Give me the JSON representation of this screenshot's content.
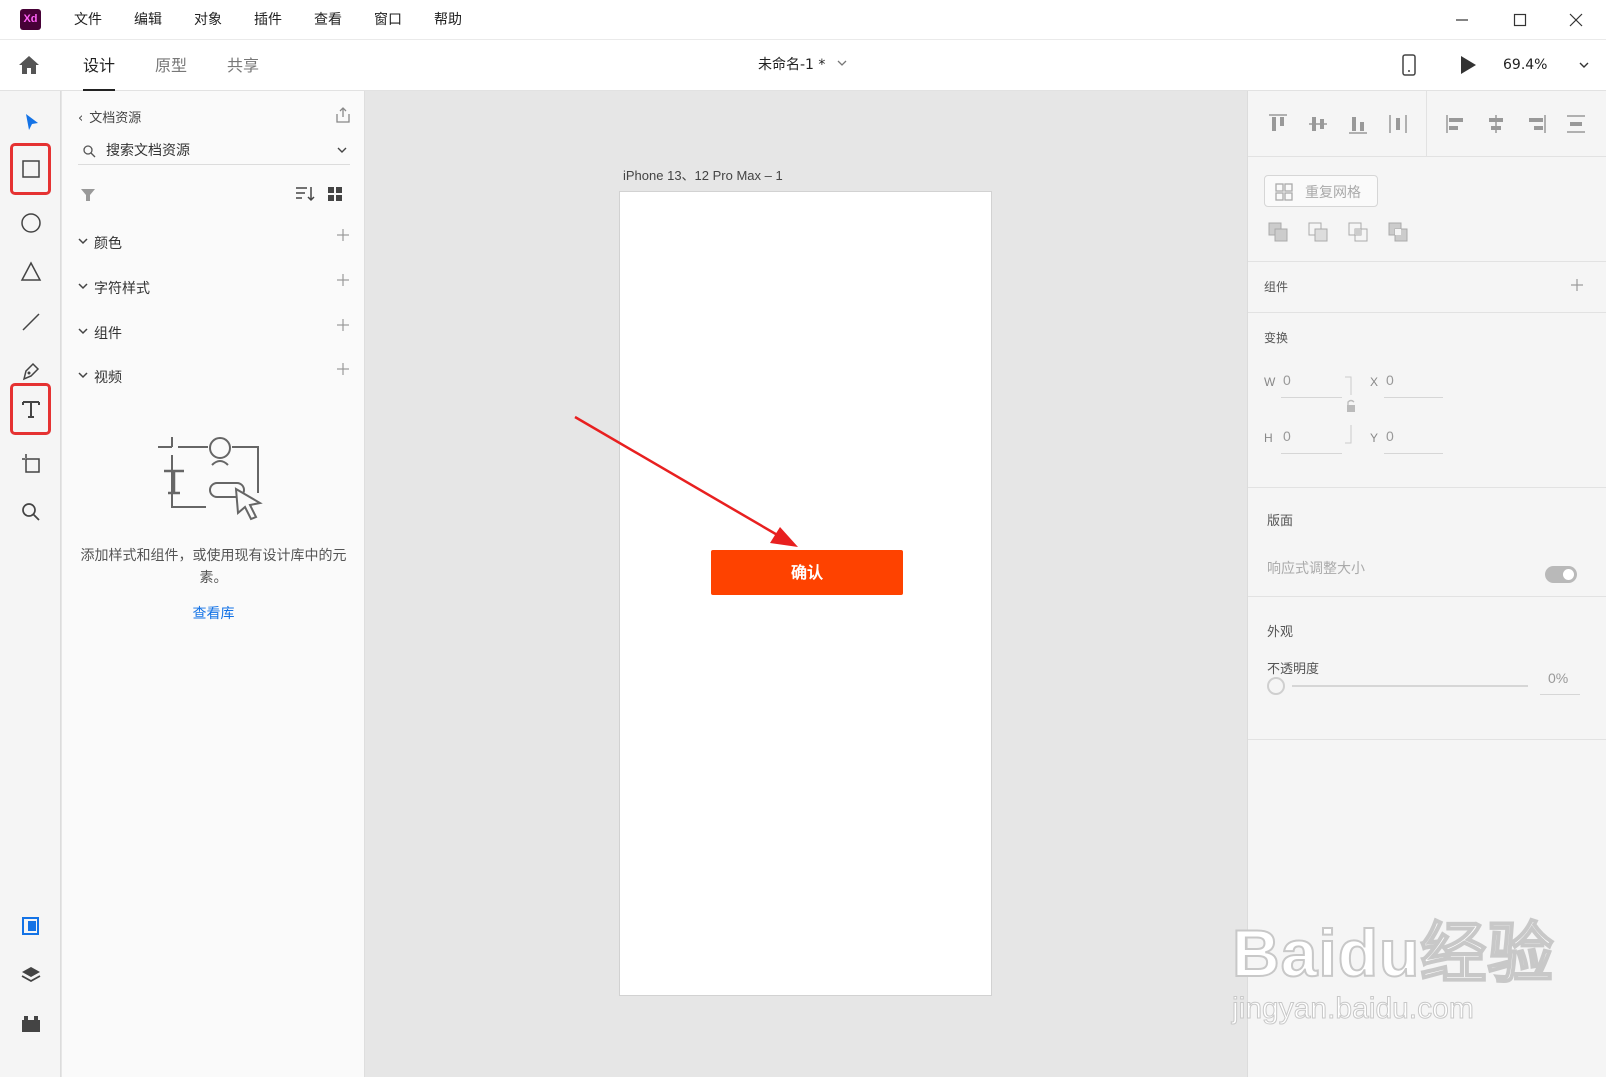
{
  "app": {
    "logo": "Xd",
    "menu": [
      "文件",
      "编辑",
      "对象",
      "插件",
      "查看",
      "窗口",
      "帮助"
    ]
  },
  "topbar": {
    "tabs": [
      "设计",
      "原型",
      "共享"
    ],
    "active_tab": "设计",
    "document_title": "未命名-1 *",
    "zoom": "69.4%"
  },
  "tools": [
    "select-tool",
    "rectangle-tool",
    "ellipse-tool",
    "polygon-tool",
    "line-tool",
    "pen-tool",
    "text-tool",
    "artboard-tool",
    "zoom-tool"
  ],
  "highlighted_tools": [
    "rectangle-tool",
    "text-tool"
  ],
  "bottom_tools": [
    "document-assets-icon",
    "layers-icon",
    "plugins-icon"
  ],
  "assets": {
    "back_label": "文档资源",
    "search_placeholder": "搜索文档资源",
    "sections": [
      "颜色",
      "字符样式",
      "组件",
      "视频"
    ],
    "empty_text": "添加样式和组件，或使用现有设计库中的元素。",
    "view_library": "查看库"
  },
  "canvas": {
    "artboard_name": "iPhone 13、12 Pro Max – 1",
    "button_label": "确认",
    "button_color": "#fe4200",
    "annotation_color": "#e82020"
  },
  "properties": {
    "repeat_grid": "重复网格",
    "components_title": "组件",
    "transform_title": "变换",
    "w_label": "W",
    "w_value": "0",
    "h_label": "H",
    "h_value": "0",
    "x_label": "X",
    "x_value": "0",
    "y_label": "Y",
    "y_value": "0",
    "layout_title": "版面",
    "responsive_resize": "响应式调整大小",
    "responsive_on": true,
    "appearance_title": "外观",
    "opacity_label": "不透明度",
    "opacity_value": "0%"
  },
  "watermark": {
    "main": "Baidu经验",
    "sub": "jingyan.baidu.com"
  }
}
